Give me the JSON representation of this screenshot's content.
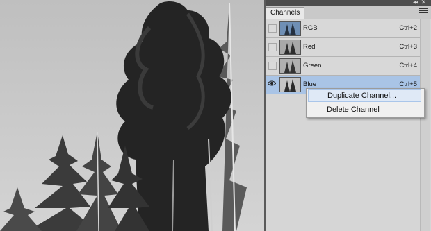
{
  "panel": {
    "tab_label": "Channels",
    "icons": {
      "collapse": "double-chevron-icon",
      "close": "close-icon",
      "menu": "panel-menu-icon",
      "visibility": "eye-icon"
    },
    "channels": [
      {
        "name": "RGB",
        "shortcut": "Ctrl+2",
        "visible": false,
        "selected": false
      },
      {
        "name": "Red",
        "shortcut": "Ctrl+3",
        "visible": false,
        "selected": false
      },
      {
        "name": "Green",
        "shortcut": "Ctrl+4",
        "visible": false,
        "selected": false
      },
      {
        "name": "Blue",
        "shortcut": "Ctrl+5",
        "visible": true,
        "selected": true
      }
    ]
  },
  "context_menu": {
    "items": [
      {
        "label": "Duplicate Channel...",
        "highlighted": true
      },
      {
        "label": "Delete Channel",
        "highlighted": false
      }
    ]
  },
  "colors": {
    "selected_row": "#a9c4e6",
    "menu_highlight": "#dfe9f6"
  }
}
